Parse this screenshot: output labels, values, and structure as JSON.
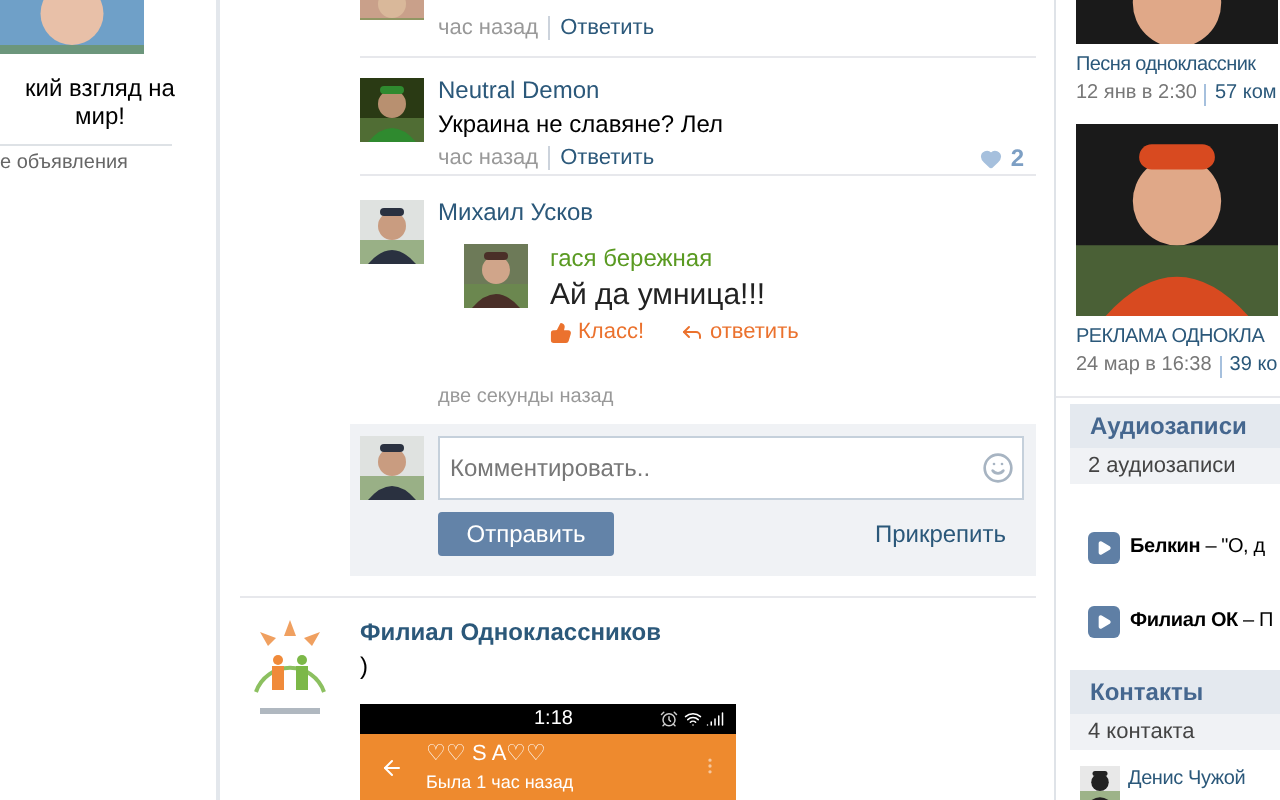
{
  "left_ad": {
    "text": "кий взгляд на мир!",
    "link": "е объявления"
  },
  "comments": [
    {
      "kind": "cut",
      "time": "час назад",
      "reply": "Ответить"
    },
    {
      "kind": "text",
      "author": "Neutral Demon",
      "text": "Украина не славяне? Лел",
      "time": "час назад",
      "reply": "Ответить",
      "likes": "2"
    },
    {
      "kind": "share",
      "author": "Михаил Усков",
      "shared": {
        "author": "гася бережная",
        "text": "Ай да умница!!!",
        "like": "Класс!",
        "reply": "ответить"
      },
      "time": "две секунды назад"
    }
  ],
  "comment_form": {
    "placeholder": "Комментировать..",
    "submit": "Отправить",
    "attach": "Прикрепить"
  },
  "post": {
    "author": "Филиал Одноклассников",
    "text": ")",
    "screenshot": {
      "time": "1:18",
      "title": "♡♡ S A♡♡",
      "status": "Была 1 час назад"
    }
  },
  "videos": [
    {
      "title": "Песня одноклассник",
      "date": "12 янв в 2:30",
      "comments": "57 ком"
    },
    {
      "title": "РЕКЛАМА ОДНОКЛА",
      "date": "24 мар в 16:38",
      "comments": "39 ко"
    }
  ],
  "audio": {
    "title": "Аудиозаписи",
    "count": "2 аудиозаписи",
    "tracks": [
      {
        "text": "**Белкин** – \"О, д"
      },
      {
        "text": "**Филиал ОК** – П"
      }
    ]
  },
  "contacts": {
    "title": "Контакты",
    "count": "4 контакта",
    "items": [
      {
        "name": "Денис Чужой"
      }
    ]
  }
}
